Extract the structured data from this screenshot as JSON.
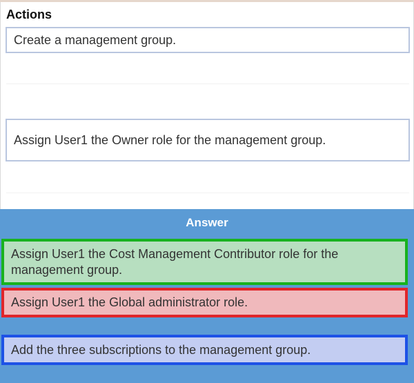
{
  "actions": {
    "title": "Actions",
    "items": [
      "Create a management group.",
      "Assign User1 the Owner role for the management group."
    ]
  },
  "answer": {
    "title": "Answer",
    "items": [
      {
        "text": "Assign User1 the Cost Management Contributor role for the management group.",
        "border_color": "#18b21f",
        "fill_color": "#b7dfc0"
      },
      {
        "text": "Assign User1 the Global administrator role.",
        "border_color": "#e0262b",
        "fill_color": "#f0b9bc"
      },
      {
        "text": "Add the three subscriptions to the management group.",
        "border_color": "#1d52e6",
        "fill_color": "#c3cdf2"
      }
    ]
  },
  "colors": {
    "answer_panel": "#5b9bd5",
    "action_border": "#b9c6df"
  }
}
